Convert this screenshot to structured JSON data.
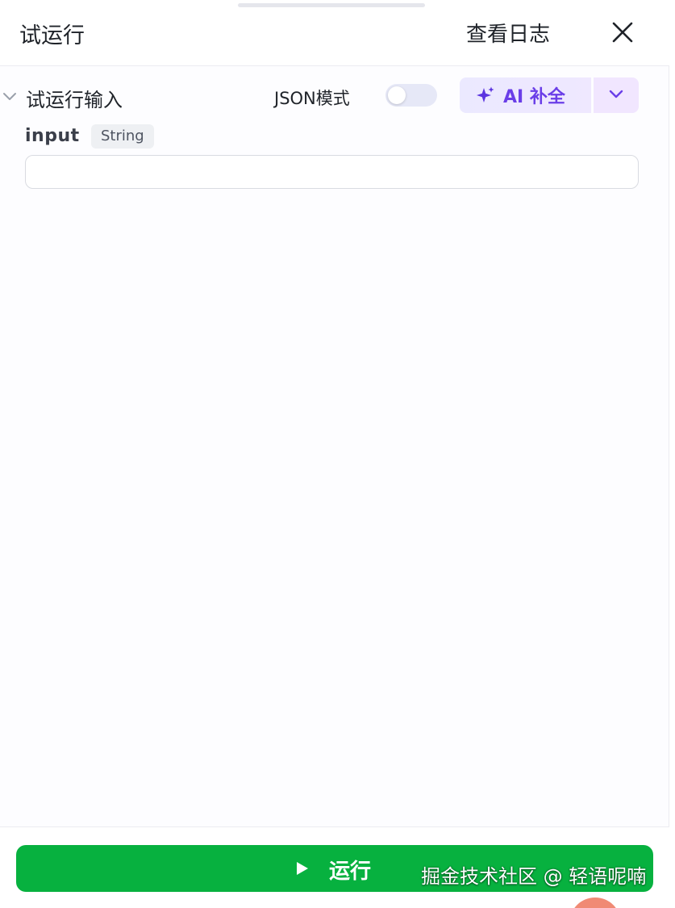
{
  "header": {
    "title": "试运行",
    "view_log_label": "查看日志"
  },
  "input_section": {
    "title": "试运行输入",
    "json_mode_label": "JSON模式",
    "json_mode_enabled": false,
    "ai_button_label": "AI 补全"
  },
  "fields": [
    {
      "name": "input",
      "type": "String",
      "value": ""
    }
  ],
  "footer": {
    "run_label": "运行"
  },
  "watermark": "掘金技术社区 @ 轻语呢喃",
  "colors": {
    "run_button": "#07b13f",
    "ai_accent": "#6a3ee8",
    "toggle_off": "#e6e8f7"
  },
  "icons": [
    "close-icon",
    "chevron-down-icon",
    "sparkle-icon",
    "play-icon"
  ]
}
